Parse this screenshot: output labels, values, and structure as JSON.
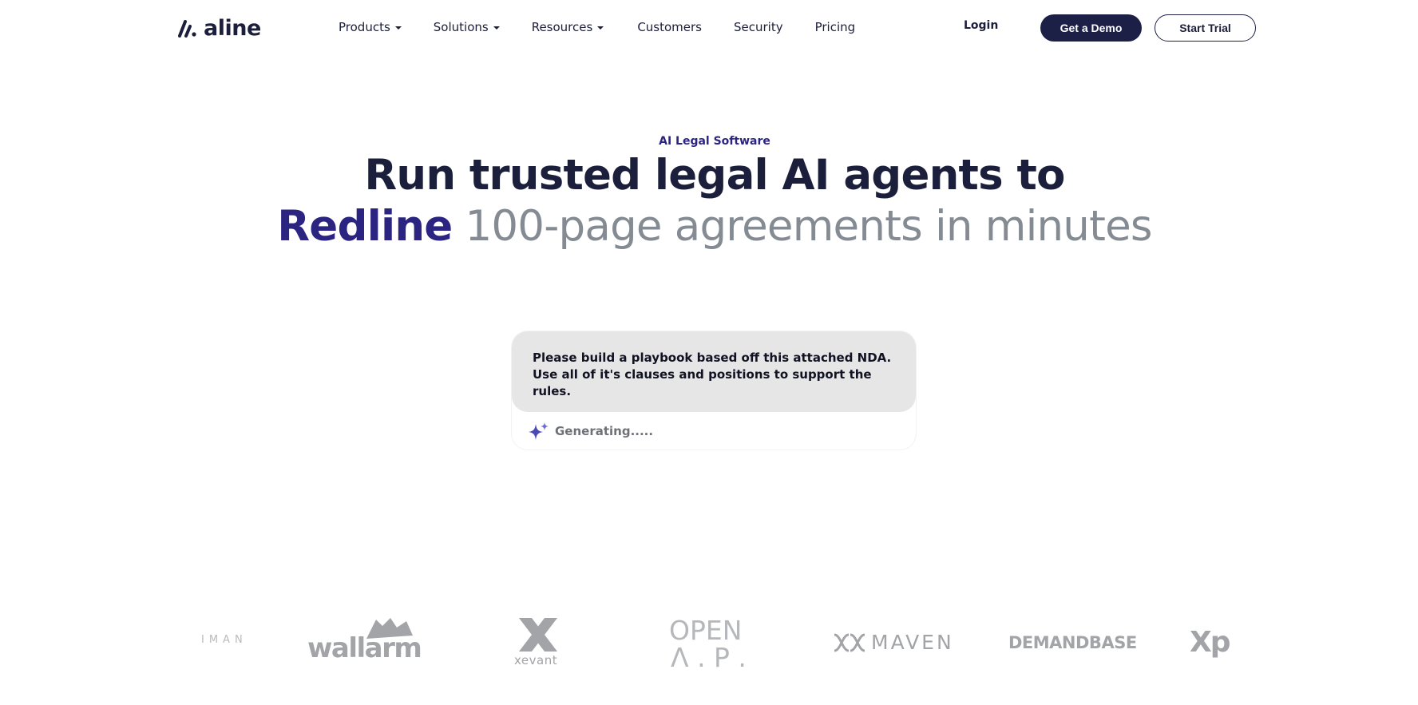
{
  "nav": {
    "brand": "aline",
    "menu": [
      {
        "label": "Products",
        "dropdown": true
      },
      {
        "label": "Solutions",
        "dropdown": true
      },
      {
        "label": "Resources",
        "dropdown": true
      },
      {
        "label": "Customers",
        "dropdown": false
      },
      {
        "label": "Security",
        "dropdown": false
      },
      {
        "label": "Pricing",
        "dropdown": false
      }
    ],
    "login": "Login",
    "demo": "Get a Demo",
    "trial": "Start Trial"
  },
  "hero": {
    "eyebrow": "AI Legal Software",
    "line1": "Run trusted legal AI agents to",
    "accent": "Redline",
    "rest": "100-page agreements in minutes"
  },
  "chat": {
    "prompt": "Please build a playbook based off this attached NDA. Use all of it's clauses and positions to support the rules.",
    "status": "Generating.....",
    "status_icon": "sparkle-icon"
  },
  "logos": {
    "items": [
      "IMAN",
      "wallarm",
      "xevant",
      "OPEN",
      "Λ . P .",
      "MAVEN",
      "DEMANDBASE",
      "Xp"
    ]
  },
  "colors": {
    "navy": "#1d2046",
    "accent": "#2b2481",
    "muted": "#858b93",
    "bubble": "#e6e6e6",
    "logo_gray": "#a2a4a8"
  }
}
